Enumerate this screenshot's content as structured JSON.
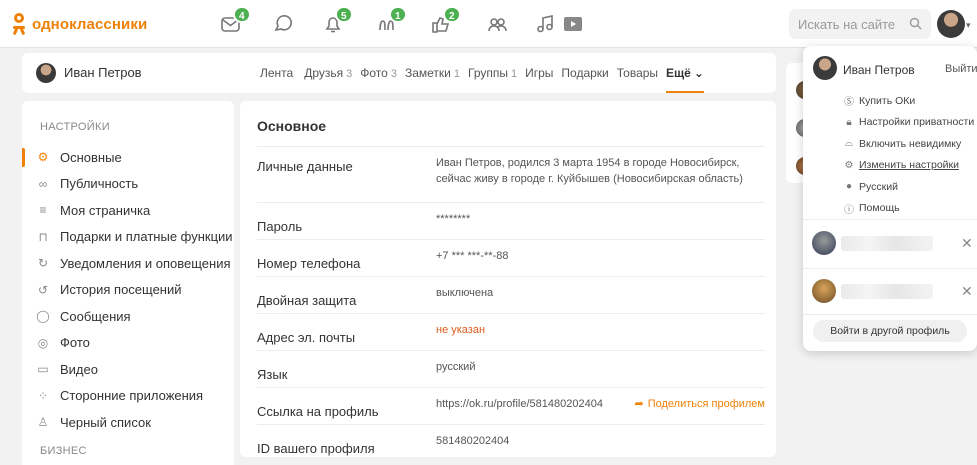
{
  "brand": {
    "name": "одноклассники",
    "color": "#ee8208"
  },
  "topbar": {
    "icons": [
      {
        "name": "messages-icon",
        "badge": "4"
      },
      {
        "name": "discussions-icon",
        "badge": ""
      },
      {
        "name": "notifications-icon",
        "badge": "5"
      },
      {
        "name": "guests-icon",
        "badge": "1"
      },
      {
        "name": "events-icon",
        "badge": "2"
      },
      {
        "name": "friends-icon",
        "badge": ""
      },
      {
        "name": "music-icon",
        "badge": ""
      },
      {
        "name": "video-icon",
        "badge": ""
      }
    ],
    "search_placeholder": "Искать на сайте"
  },
  "profile": {
    "name": "Иван Петров",
    "tabs": [
      {
        "label": "Лента",
        "count": ""
      },
      {
        "label": "Друзья",
        "count": "3"
      },
      {
        "label": "Фото",
        "count": "3"
      },
      {
        "label": "Заметки",
        "count": "1"
      },
      {
        "label": "Группы",
        "count": "1"
      },
      {
        "label": "Игры",
        "count": ""
      },
      {
        "label": "Подарки",
        "count": ""
      },
      {
        "label": "Товары",
        "count": ""
      }
    ],
    "more_label": "Ещё"
  },
  "sidebar": {
    "section_title": "Настройки",
    "items": [
      {
        "label": "Основные",
        "icon": "gear-icon",
        "active": true
      },
      {
        "label": "Публичность",
        "icon": "glasses-icon",
        "active": false
      },
      {
        "label": "Моя страничка",
        "icon": "list-icon",
        "active": false
      },
      {
        "label": "Подарки и платные функции",
        "icon": "gift-icon",
        "active": false
      },
      {
        "label": "Уведомления и оповещения",
        "icon": "refresh-icon",
        "active": false
      },
      {
        "label": "История посещений",
        "icon": "history-icon",
        "active": false
      },
      {
        "label": "Сообщения",
        "icon": "message-icon",
        "active": false
      },
      {
        "label": "Фото",
        "icon": "camera-icon",
        "active": false
      },
      {
        "label": "Видео",
        "icon": "video-icon",
        "active": false
      },
      {
        "label": "Сторонние приложения",
        "icon": "apps-icon",
        "active": false
      },
      {
        "label": "Черный список",
        "icon": "block-user-icon",
        "active": false
      }
    ],
    "section2_title": "Бизнес"
  },
  "main": {
    "title": "Основное",
    "rows": [
      {
        "label": "Личные данные",
        "value": "Иван Петров, родился 3 марта 1954 в городе Новосибирск, сейчас живу в городе г. Куйбышев (Новосибирская область)"
      },
      {
        "label": "Пароль",
        "value": "********"
      },
      {
        "label": "Номер телефона",
        "value": "+7 *** ***-**-88"
      },
      {
        "label": "Двойная защита",
        "value": "выключена"
      },
      {
        "label": "Адрес эл. почты",
        "value": "не указан"
      },
      {
        "label": "Язык",
        "value": "русский"
      },
      {
        "label": "Ссылка на профиль",
        "value": "https://ok.ru/profile/581480202404"
      },
      {
        "label": "ID вашего профиля",
        "value": "581480202404"
      }
    ],
    "share_label": "Поделиться профилем",
    "warn_color": "#e05a1c"
  },
  "dropdown": {
    "name": "Иван Петров",
    "exit_label": "Выйти",
    "menu": [
      {
        "label": "Купить ОКи",
        "icon": "ok-coin-icon"
      },
      {
        "label": "Настройки приватности",
        "icon": "lock-icon"
      },
      {
        "label": "Включить невидимку",
        "icon": "invisible-icon"
      },
      {
        "label": "Изменить настройки",
        "icon": "gear-icon"
      },
      {
        "label": "Русский",
        "icon": "globe-icon"
      },
      {
        "label": "Помощь",
        "icon": "help-icon"
      }
    ],
    "other_profile_label": "Войти в другой профиль"
  }
}
